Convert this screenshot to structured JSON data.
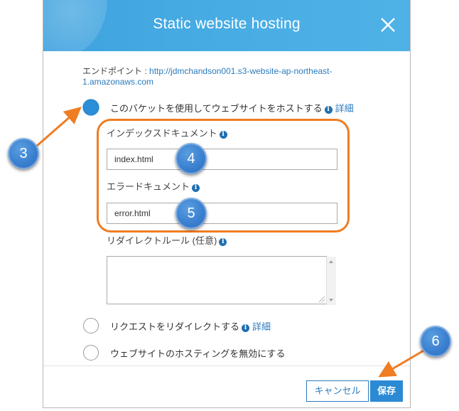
{
  "modal": {
    "title": "Static website hosting",
    "endpoint_label": "エンドポイント : ",
    "endpoint_url_line1": "http://jdmchandson001.s3-website-ap-northeast-",
    "endpoint_url_line2": "1.amazonaws.com"
  },
  "options": {
    "host": {
      "label": "このバケットを使用してウェブサイトをホストする",
      "link": "詳細",
      "selected": true
    },
    "redirect": {
      "label": "リクエストをリダイレクトする",
      "link": "詳細",
      "selected": false
    },
    "disable": {
      "label": "ウェブサイトのホスティングを無効にする",
      "selected": false
    }
  },
  "fields": {
    "index_label": "インデックスドキュメント",
    "index_value": "index.html",
    "error_label": "エラードキュメント",
    "error_value": "error.html",
    "redirect_rules_label": "リダイレクトルール (任意)",
    "redirect_rules_value": ""
  },
  "buttons": {
    "cancel": "キャンセル",
    "save": "保存"
  },
  "callouts": {
    "c3": "3",
    "c4": "4",
    "c5": "5",
    "c6": "6"
  },
  "icons": {
    "close": "close-icon",
    "info": "info-icon"
  },
  "colors": {
    "header": "#45aae2",
    "accent_blue": "#2b7bbf",
    "annotation_orange": "#ef7d22",
    "callout_blue": "#3a7fcf"
  }
}
